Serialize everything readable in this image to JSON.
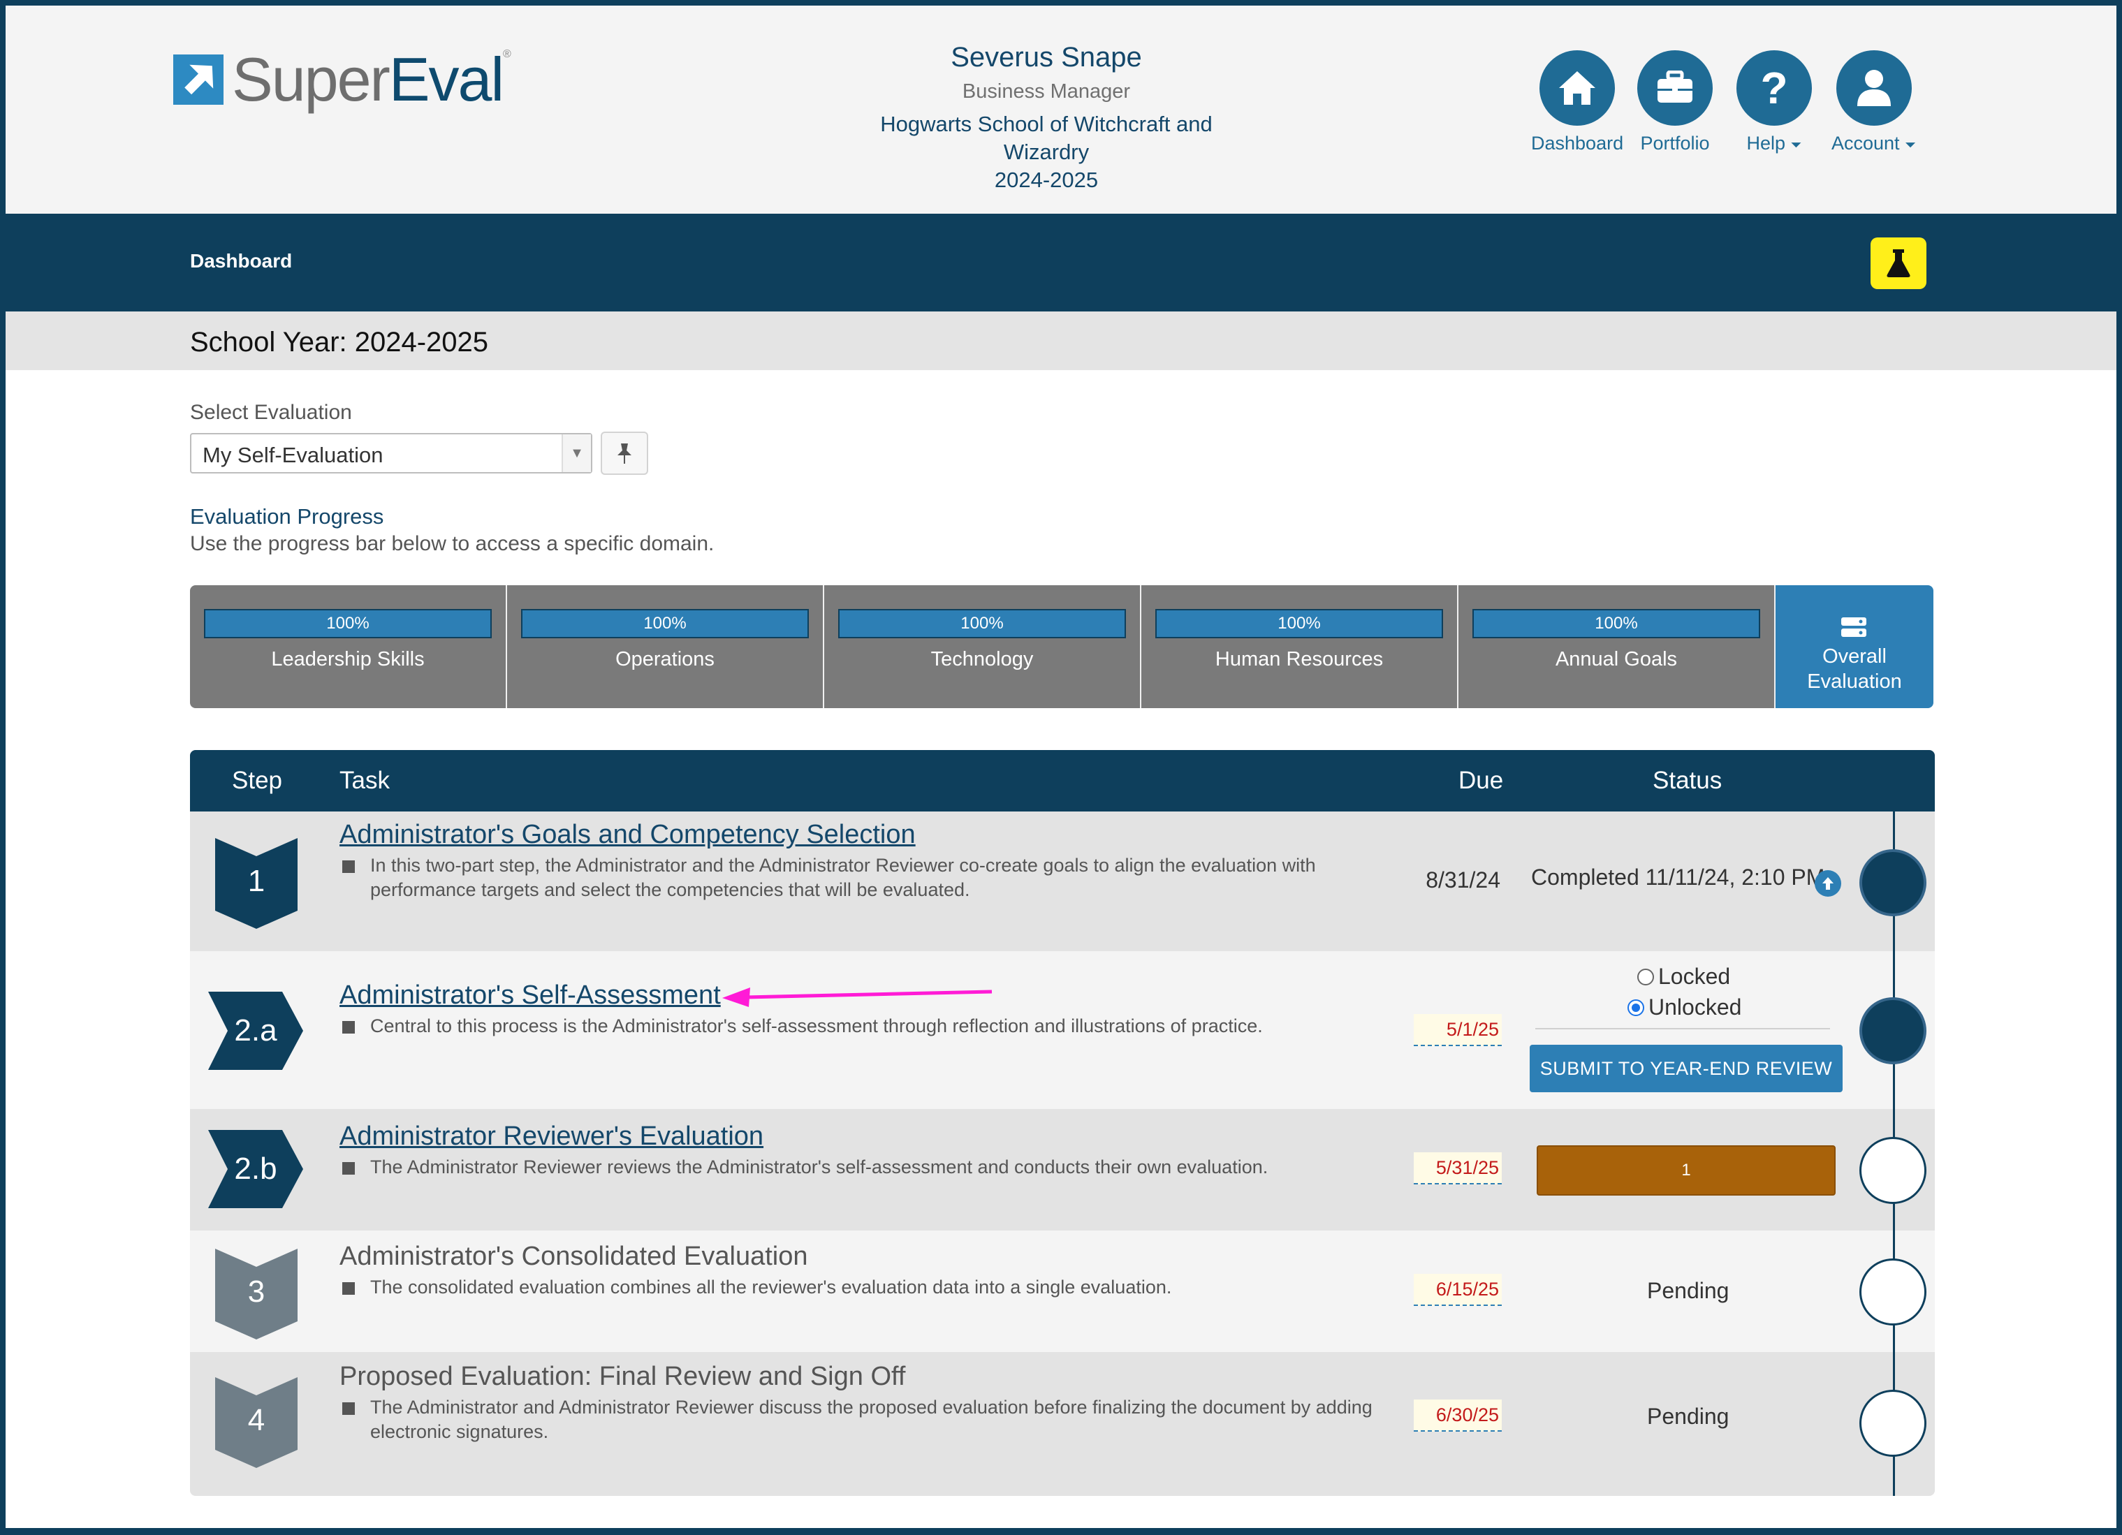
{
  "brand": {
    "super": "Super",
    "eval": "Eval",
    "tm": "®"
  },
  "user": {
    "name": "Severus Snape",
    "role": "Business Manager",
    "school_line1": "Hogwarts School of Witchcraft and",
    "school_line2": "Wizardry",
    "year": "2024-2025"
  },
  "topnav": {
    "dashboard": "Dashboard",
    "portfolio": "Portfolio",
    "help": "Help",
    "account": "Account",
    "caret": "⏷"
  },
  "navbar": {
    "breadcrumb": "Dashboard"
  },
  "school_year": "School Year: 2024-2025",
  "select_evaluation": {
    "label": "Select Evaluation",
    "value": "My Self-Evaluation",
    "arrow": "▼"
  },
  "progress": {
    "title": "Evaluation Progress",
    "subtitle": "Use the progress bar below to access a specific domain.",
    "domains": [
      {
        "name": "Leadership Skills",
        "percent": "100%",
        "value": 1.0
      },
      {
        "name": "Operations",
        "percent": "100%",
        "value": 1.0
      },
      {
        "name": "Technology",
        "percent": "100%",
        "value": 1.0
      },
      {
        "name": "Human Resources",
        "percent": "100%",
        "value": 1.0
      },
      {
        "name": "Annual Goals",
        "percent": "100%",
        "value": 1.0
      }
    ],
    "overall_line1": "Overall",
    "overall_line2": "Evaluation"
  },
  "table": {
    "headers": {
      "step": "Step",
      "task": "Task",
      "due": "Due",
      "status": "Status"
    },
    "rows": [
      {
        "step": "1",
        "title": "Administrator's Goals and Competency Selection",
        "desc": "In this two-part step, the Administrator and the Administrator Reviewer co-create goals to align the evaluation with performance targets and select the competencies that will be evaluated.",
        "due": "8/31/24",
        "status": "Completed 11/11/24, 2:10 PM"
      },
      {
        "step": "2.a",
        "title": "Administrator's Self-Assessment",
        "desc": "Central to this process is the Administrator's self-assessment through reflection and illustrations of practice.",
        "due": "5/1/25",
        "radio_locked": "Locked",
        "radio_unlocked": "Unlocked",
        "button": "SUBMIT TO YEAR-END REVIEW"
      },
      {
        "step": "2.b",
        "title": "Administrator Reviewer's Evaluation",
        "desc": "The Administrator Reviewer reviews the Administrator's self-assessment and conducts their own evaluation.",
        "due": "5/31/25",
        "count": "1"
      },
      {
        "step": "3",
        "title": "Administrator's Consolidated Evaluation",
        "desc": "The consolidated evaluation combines all the reviewer's evaluation data into a single evaluation.",
        "due": "6/15/25",
        "status": "Pending"
      },
      {
        "step": "4",
        "title": "Proposed Evaluation: Final Review and Sign Off",
        "desc": "The Administrator and Administrator Reviewer discuss the proposed evaluation before finalizing the document by adding electronic signatures.",
        "due": "6/30/25",
        "status": "Pending"
      }
    ]
  },
  "colors": {
    "navy": "#0e3f5c",
    "accent_blue": "#2d7fb5",
    "highlight_yellow": "#ffef1a",
    "annotation_magenta": "#ff1bd6",
    "count_orange": "#a8620a"
  }
}
